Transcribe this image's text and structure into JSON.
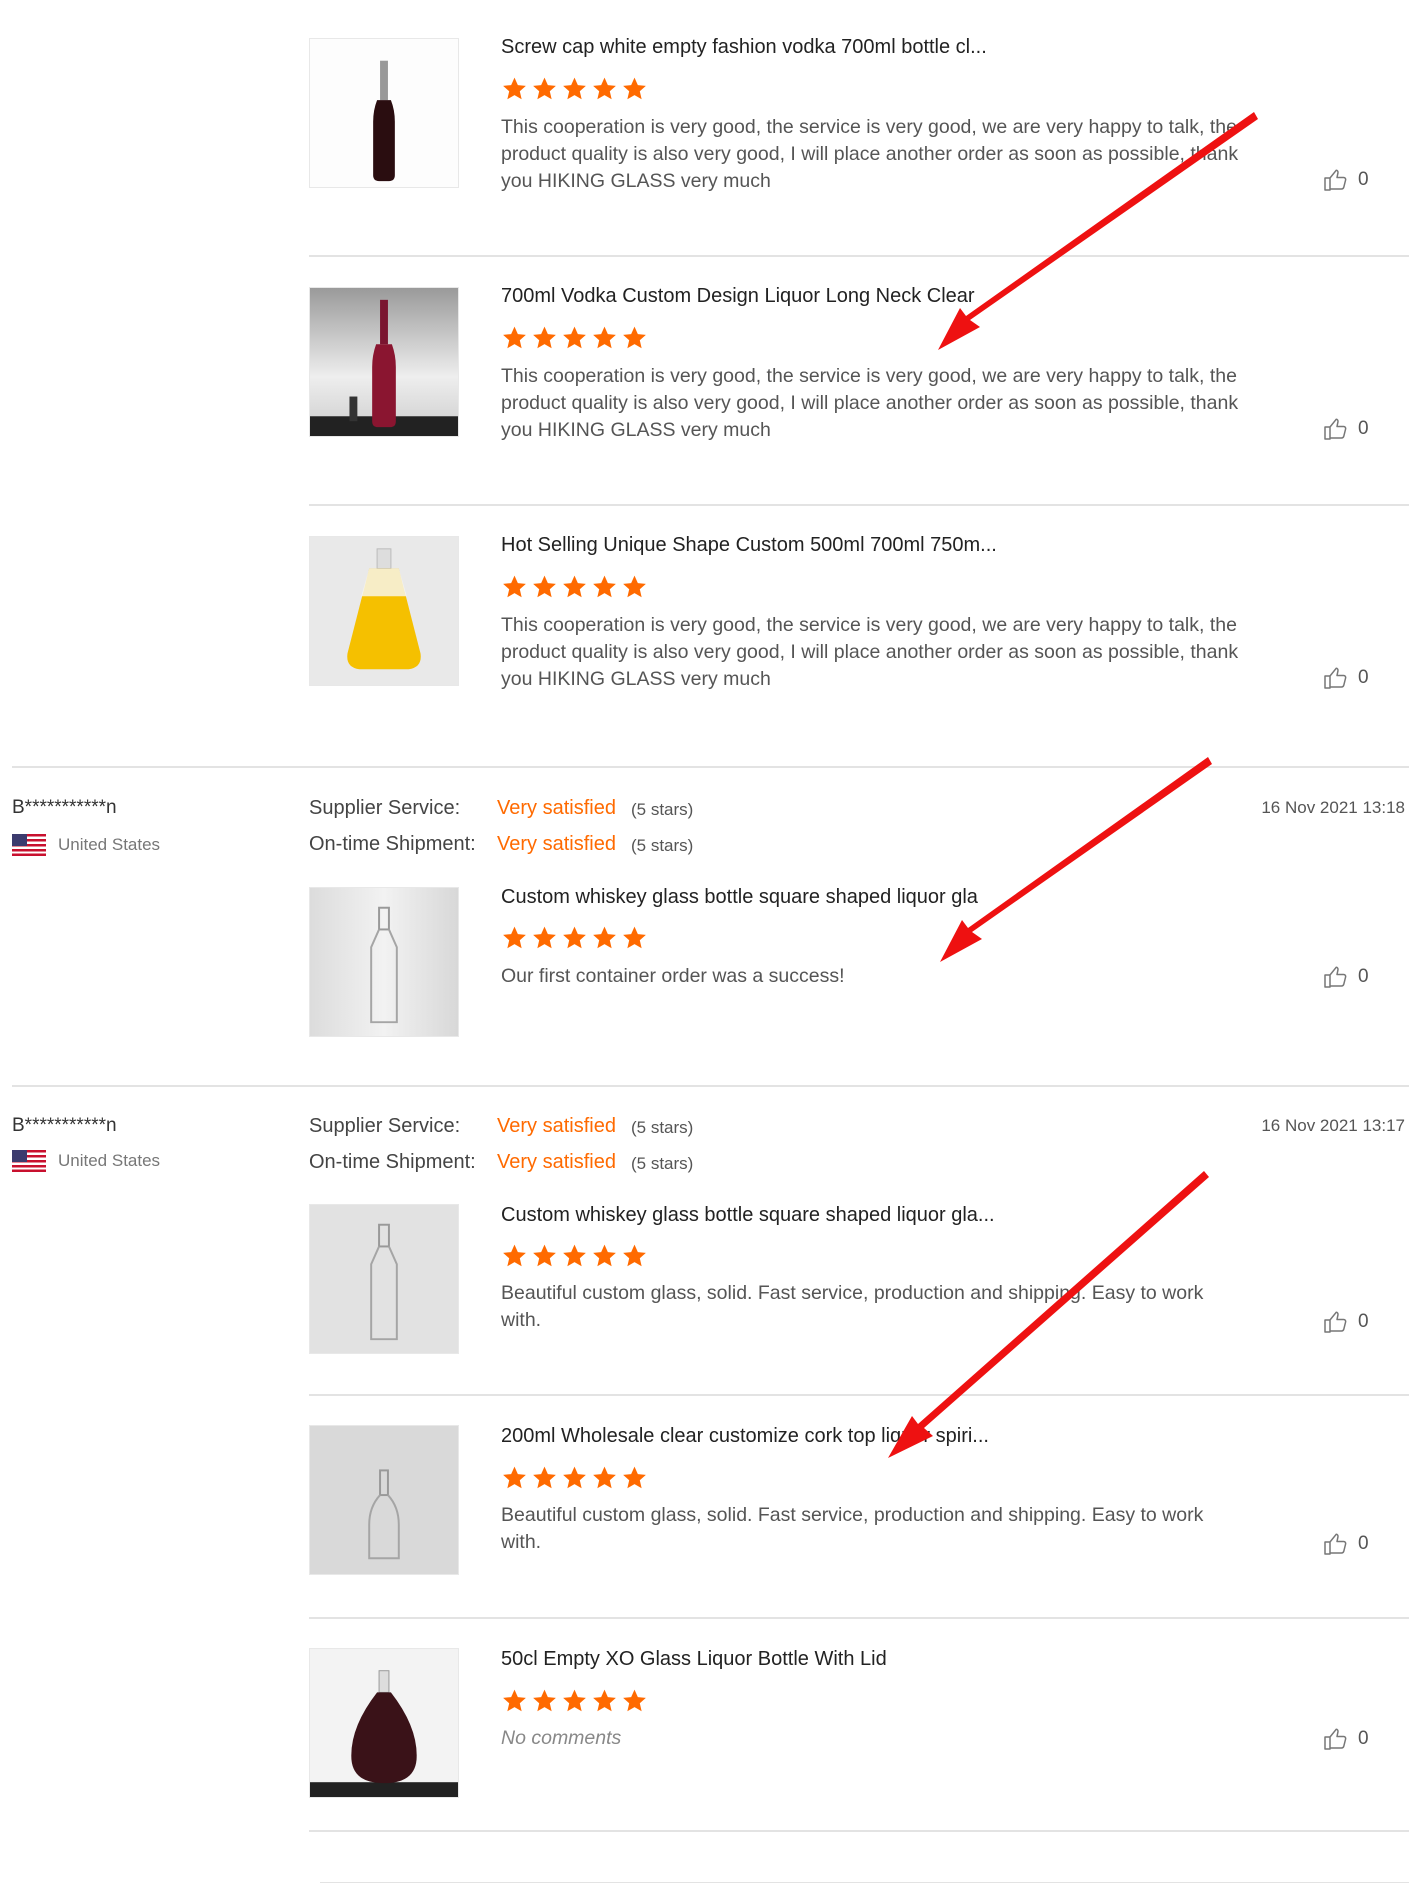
{
  "reviews": [
    {
      "title": "Screw cap white empty fashion vodka 700ml bottle cl...",
      "comment": "This cooperation is very good, the service is very good, we are very happy to talk, the product quality is also very good, I will place another order as soon as possible, thank you HIKING GLASS very much",
      "likes": "0",
      "rating": 5,
      "thumb_icon": "dark-wine-bottle-image"
    },
    {
      "title": "700ml Vodka Custom Design Liquor Long Neck Clear",
      "comment": "This cooperation is very good, the service is very good, we are very happy to talk, the product quality is also very good, I will place another order as soon as possible, thank you HIKING GLASS very much",
      "likes": "0",
      "rating": 5,
      "thumb_icon": "red-bottle-image"
    },
    {
      "title": "Hot Selling Unique Shape Custom 500ml 700ml 750m...",
      "comment": "This cooperation is very good, the service is very good, we are very happy to talk, the product quality is also very good, I will place another order as soon as possible, thank you HIKING GLASS very much",
      "likes": "0",
      "rating": 5,
      "thumb_icon": "yellow-bottle-image"
    }
  ],
  "buyer1": {
    "name": "B***********n",
    "country": "United States",
    "date": "16 Nov 2021 13:18",
    "supplier_label": "Supplier Service:",
    "supplier_value": "Very satisfied",
    "supplier_stars": "(5 stars)",
    "shipment_label": "On-time Shipment:",
    "shipment_value": "Very satisfied",
    "shipment_stars": "(5 stars)",
    "review": {
      "title": "Custom whiskey glass bottle square shaped liquor gla",
      "comment": "Our first container order was a success!",
      "likes": "0",
      "rating": 5,
      "thumb_icon": "clear-square-bottle-image"
    }
  },
  "buyer2": {
    "name": "B***********n",
    "country": "United States",
    "date": "16 Nov 2021 13:17",
    "supplier_label": "Supplier Service:",
    "supplier_value": "Very satisfied",
    "supplier_stars": "(5 stars)",
    "shipment_label": "On-time Shipment:",
    "shipment_value": "Very satisfied",
    "shipment_stars": "(5 stars)",
    "reviews": [
      {
        "title": "Custom whiskey glass bottle square shaped liquor gla...",
        "comment": "Beautiful custom glass, solid. Fast service, production and shipping. Easy to work with.",
        "likes": "0",
        "rating": 5,
        "thumb_icon": "clear-square-bottle-image"
      },
      {
        "title": "200ml Wholesale clear customize cork top liquor spiri...",
        "comment": "Beautiful custom glass, solid. Fast service, production and shipping. Easy to work with.",
        "likes": "0",
        "rating": 5,
        "thumb_icon": "small-clear-bottle-image"
      },
      {
        "title": "50cl Empty XO Glass Liquor Bottle With Lid",
        "comment": "No comments",
        "likes": "0",
        "rating": 5,
        "thumb_icon": "xo-bottle-image"
      }
    ]
  },
  "colors": {
    "accent": "#ff6a00",
    "arrow": "#ee1111",
    "star": "#ff6a00"
  }
}
